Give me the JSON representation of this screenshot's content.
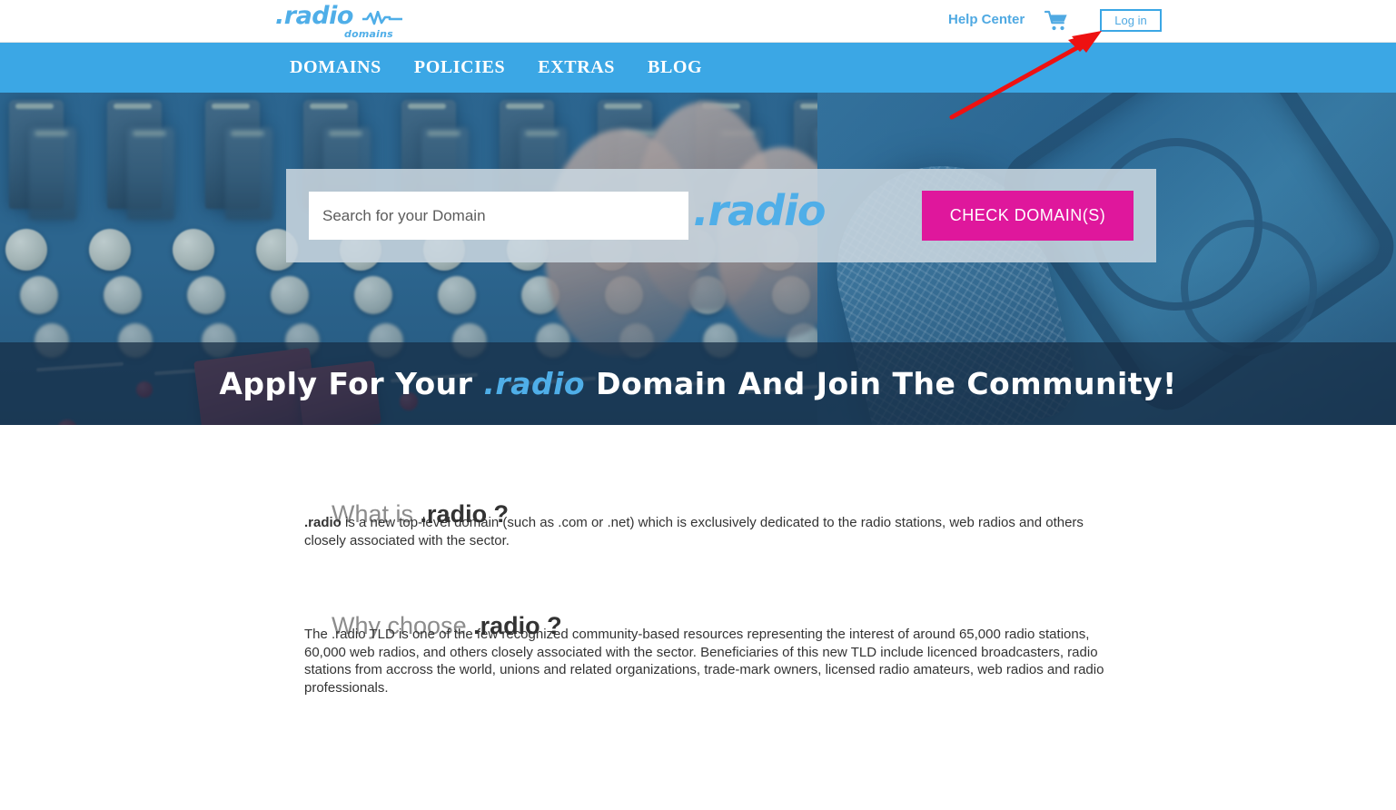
{
  "topbar": {
    "logo": {
      "main": ".radio",
      "sub": "domains",
      "wave_icon": "audio-waveform-icon"
    },
    "help_center": "Help Center",
    "cart_icon": "shopping-cart-icon",
    "login": "Log in"
  },
  "nav": {
    "items": [
      {
        "label": "DOMAINS"
      },
      {
        "label": "POLICIES"
      },
      {
        "label": "EXTRAS"
      },
      {
        "label": "BLOG"
      }
    ]
  },
  "hero": {
    "search": {
      "placeholder": "Search for your Domain",
      "value": "",
      "tld_label": ".radio",
      "button": "CHECK DOMAIN(S)"
    },
    "title": {
      "before": "Apply For Your ",
      "highlight": ".radio",
      "after": " Domain And Join The Community!"
    }
  },
  "content": {
    "sections": [
      {
        "heading_light": "What is ",
        "heading_bold": ".radio ?",
        "body_bold": ".radio",
        "body": " is a new top-level domain (such as .com or .net) which is exclusively dedicated to the radio stations, web radios and others closely associated with the sector."
      },
      {
        "heading_light": "Why choose ",
        "heading_bold": ".radio ?",
        "body_bold": "",
        "body": "The .radio TLD is one of the few recognized community-based resources representing the interest of around 65,000 radio stations, 60,000 web radios, and others closely associated with the sector. Beneficiaries of this new TLD include licenced broadcasters, radio stations from accross the world, unions and related organizations, trade-mark owners, licensed radio amateurs, web radios and radio professionals."
      }
    ]
  },
  "annotation": {
    "arrow_icon": "red-arrow-pointer",
    "color": "#EE1111",
    "points_to": "Log in"
  },
  "colors": {
    "brand_blue": "#3BA7E5",
    "logo_blue": "#4FAEE8",
    "accent_magenta": "#DF179C",
    "panel_grey": "#C9D6DF",
    "annotation_red": "#EE1111"
  }
}
